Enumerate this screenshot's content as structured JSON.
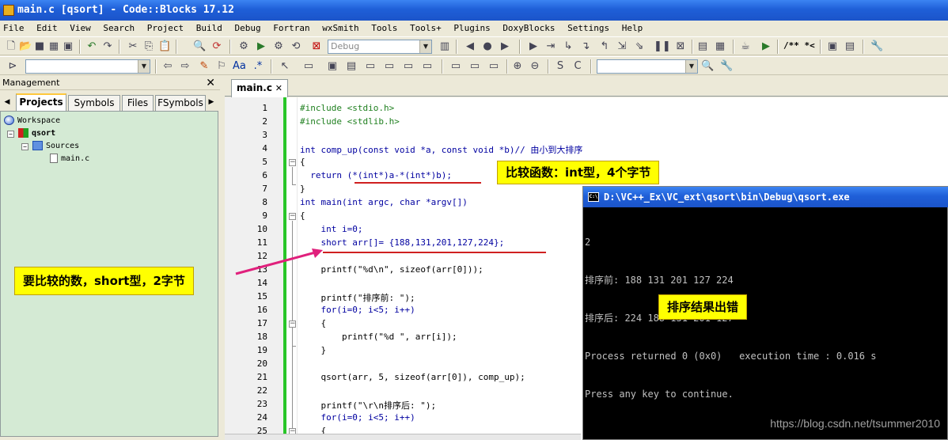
{
  "window": {
    "title": "main.c [qsort] - Code::Blocks 17.12"
  },
  "menu": [
    "File",
    "Edit",
    "View",
    "Search",
    "Project",
    "Build",
    "Debug",
    "Fortran",
    "wxSmith",
    "Tools",
    "Tools+",
    "Plugins",
    "DoxyBlocks",
    "Settings",
    "Help"
  ],
  "toolbar": {
    "build_target": "Debug",
    "doxy_label": "/** *<"
  },
  "management": {
    "title": "Management",
    "tabs": [
      "Projects",
      "Symbols",
      "Files",
      "FSymbols"
    ],
    "tree": {
      "workspace": "Workspace",
      "project": "qsort",
      "folder": "Sources",
      "file": "main.c"
    }
  },
  "editor": {
    "tab": "main.c",
    "line_numbers": [
      "1",
      "2",
      "3",
      "4",
      "5",
      "6",
      "7",
      "8",
      "9",
      "10",
      "11",
      "12",
      "13",
      "14",
      "15",
      "16",
      "17",
      "18",
      "19",
      "20",
      "21",
      "22",
      "23",
      "24",
      "25"
    ],
    "lines": [
      "#include <stdio.h>",
      "#include <stdlib.h>",
      "",
      "int comp_up(const void *a, const void *b)// 由小到大排序",
      "{",
      "  return (*(int*)a-*(int*)b);",
      "}",
      "int main(int argc, char *argv[])",
      "{",
      "    int i=0;",
      "    short arr[]= {188,131,201,127,224};",
      "",
      "    printf(\"%d\\n\", sizeof(arr[0]));",
      "",
      "    printf(\"排序前: \");",
      "    for(i=0; i<5; i++)",
      "    {",
      "        printf(\"%d \", arr[i]);",
      "    }",
      "",
      "    qsort(arr, 5, sizeof(arr[0]), comp_up);",
      "",
      "    printf(\"\\r\\n排序后: \");",
      "    for(i=0; i<5; i++)",
      "    {"
    ]
  },
  "console": {
    "title": "D:\\VC++_Ex\\VC_ext\\qsort\\bin\\Debug\\qsort.exe",
    "lines": [
      "2",
      "排序前: 188 131 201 127 224",
      "排序后: 224 188 131 201 127",
      "Process returned 0 (0x0)   execution time : 0.016 s",
      "Press any key to continue."
    ]
  },
  "annotations": {
    "compare": "比较函数：int型，4个字节",
    "short_note": "要比较的数，short型，2字节",
    "result_error": "排序结果出错"
  },
  "watermark": "https://blog.csdn.net/tsummer2010",
  "colors": {
    "title_bar": "#1f5fd8",
    "callout": "#ffff00",
    "tree_bg": "#d4ead4",
    "change_bar": "#29c629",
    "underline": "#d02020"
  }
}
